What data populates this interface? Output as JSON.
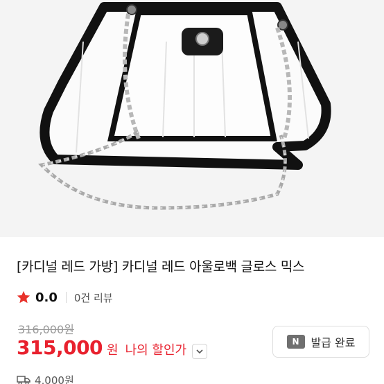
{
  "product": {
    "title": "[카디널 레드 가방] 카디널 레드 아울로백 글로스 믹스",
    "image_icon": "handbag-photo"
  },
  "rating": {
    "value": "0.0",
    "reviews": "0건 리뷰",
    "icon": "star-icon",
    "star_color": "#e8322b"
  },
  "price": {
    "original": "316,000원",
    "sale": "315,000",
    "currency": "원",
    "discount_label": "나의 할인가",
    "sale_color": "#e8212e"
  },
  "coupon": {
    "icon_text": "N",
    "label": "발급 완료"
  },
  "shipping": {
    "icon": "truck-icon",
    "fee": "4,000원"
  }
}
